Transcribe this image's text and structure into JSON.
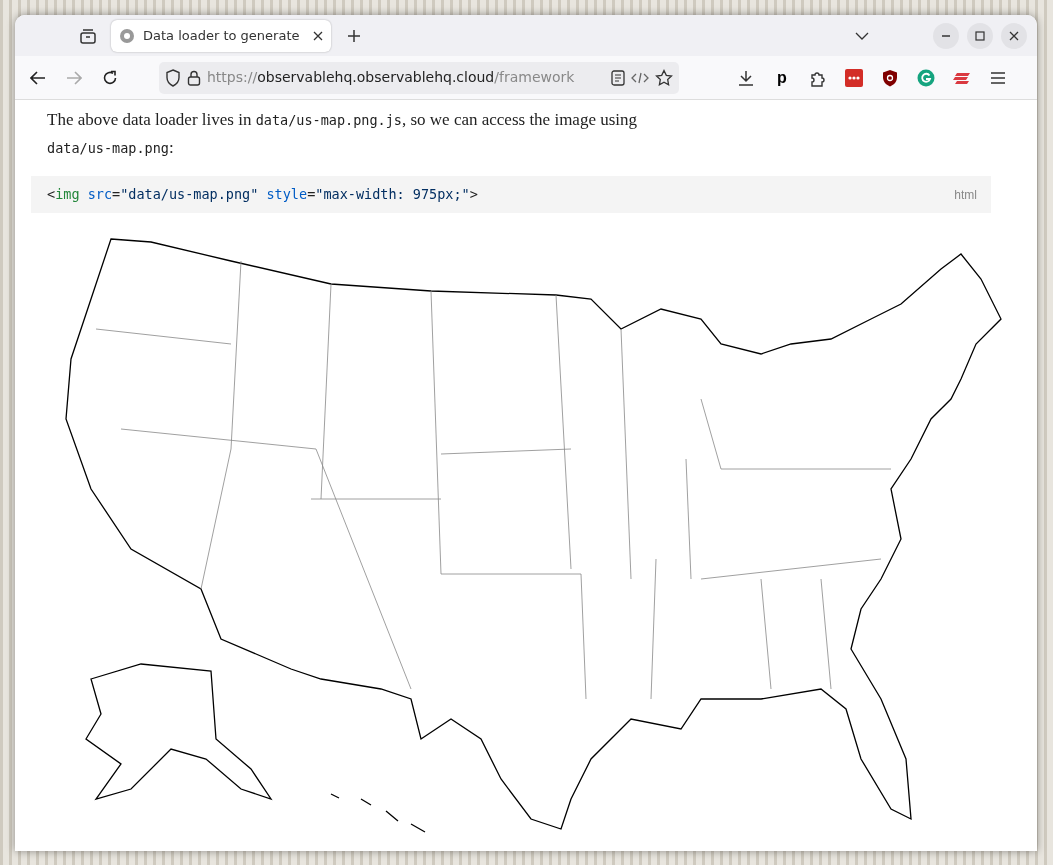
{
  "browser": {
    "tabs": [
      {
        "title": "Data loader to generate",
        "selected": true
      }
    ],
    "url": {
      "scheme": "https://",
      "host": "observablehq.observablehq.cloud",
      "path": "/framework"
    },
    "extension_letter": "p"
  },
  "page": {
    "paragraph": [
      {
        "kind": "text",
        "text": "The above data loader lives in "
      },
      {
        "kind": "code",
        "text": "data/us-map.png.js"
      },
      {
        "kind": "text",
        "text": ", so we can access the image using "
      },
      {
        "kind": "code",
        "text": "data/us-map.png"
      },
      {
        "kind": "text",
        "text": ":"
      }
    ],
    "code_block": {
      "language": "html",
      "tokens": [
        {
          "kind": "punct",
          "text": "<"
        },
        {
          "kind": "tag",
          "text": "img"
        },
        {
          "kind": "attr",
          "text": "src"
        },
        {
          "kind": "punct",
          "text": "="
        },
        {
          "kind": "string",
          "text": "\"data/us-map.png\""
        },
        {
          "kind": "attr",
          "text": "style"
        },
        {
          "kind": "punct",
          "text": "="
        },
        {
          "kind": "string",
          "text": "\"max-width: 975px;\""
        },
        {
          "kind": "punct",
          "text": ">"
        }
      ]
    }
  }
}
